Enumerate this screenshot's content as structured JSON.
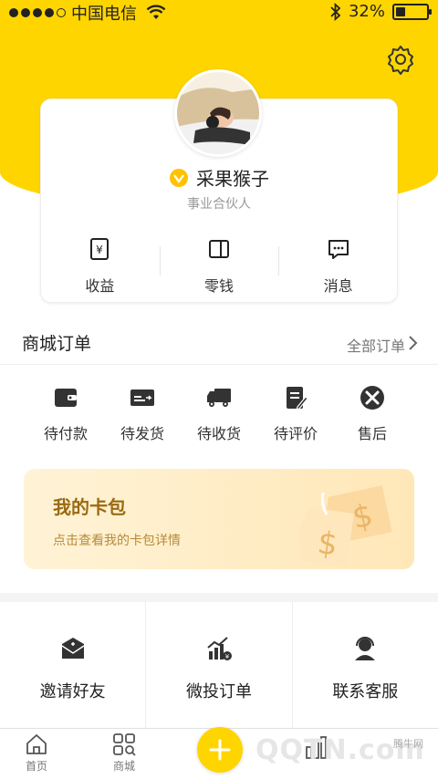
{
  "status_bar": {
    "carrier": "中国电信",
    "battery": "32%",
    "battery_level": 0.32
  },
  "profile": {
    "name": "采果猴子",
    "role": "事业合伙人"
  },
  "card_actions": [
    {
      "label": "收益",
      "icon": "income-icon"
    },
    {
      "label": "零钱",
      "icon": "wallet-icon"
    },
    {
      "label": "消息",
      "icon": "message-icon"
    }
  ],
  "orders": {
    "title": "商城订单",
    "all_label": "全部订单",
    "items": [
      {
        "label": "待付款",
        "icon": "wallet-pay-icon"
      },
      {
        "label": "待发货",
        "icon": "card-ship-icon"
      },
      {
        "label": "待收货",
        "icon": "truck-icon"
      },
      {
        "label": "待评价",
        "icon": "edit-review-icon"
      },
      {
        "label": "售后",
        "icon": "tools-icon"
      }
    ]
  },
  "card_bag": {
    "title": "我的卡包",
    "subtitle": "点击查看我的卡包详情"
  },
  "grid": [
    {
      "label": "邀请好友",
      "icon": "invite-mail-icon"
    },
    {
      "label": "微投订单",
      "icon": "investment-chart-icon"
    },
    {
      "label": "联系客服",
      "icon": "customer-service-icon"
    }
  ],
  "tabbar": {
    "items": [
      {
        "label": "首页",
        "icon": "home-icon"
      },
      {
        "label": "商城",
        "icon": "mall-icon"
      }
    ],
    "watermark": "QQTN.com",
    "watermark_sub": "腾牛网"
  },
  "colors": {
    "brand_yellow": "#ffd500",
    "card_gold": "#9a6a12"
  }
}
